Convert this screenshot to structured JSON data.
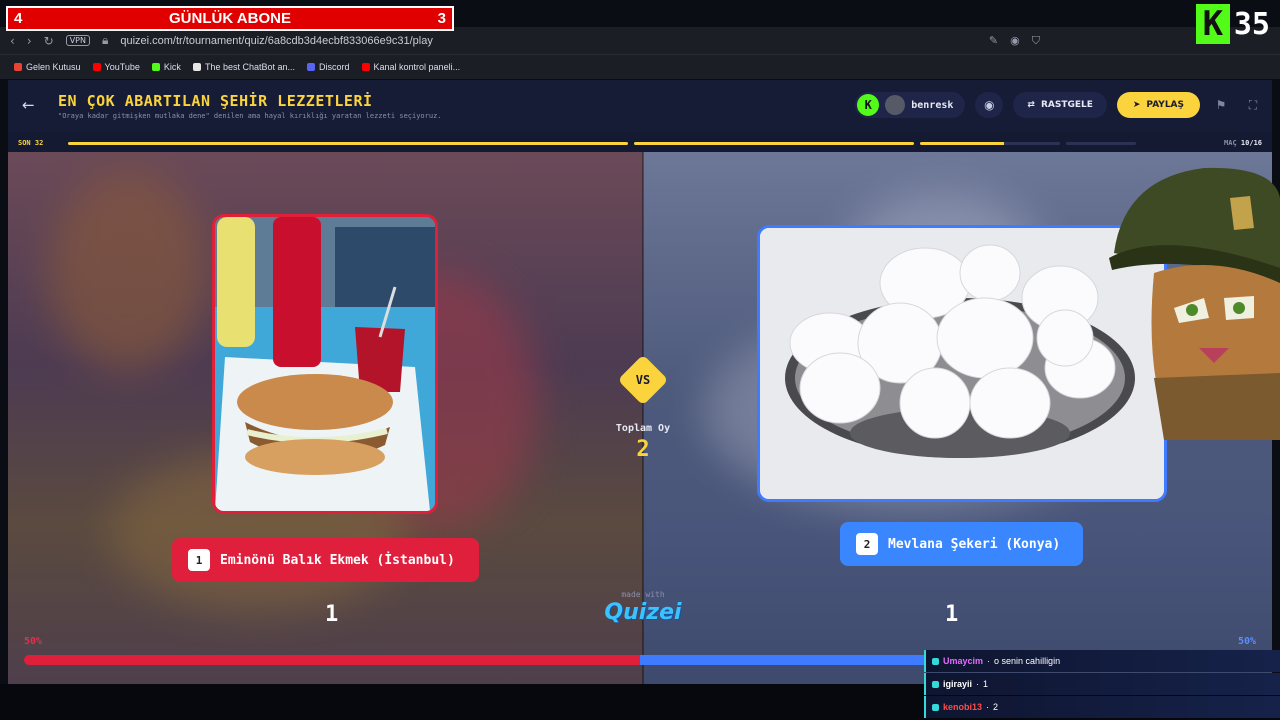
{
  "overlay": {
    "sub_left": "4",
    "sub_title": "GÜNLÜK ABONE",
    "sub_right": "3",
    "kick_letter": "K",
    "kick_count": "35"
  },
  "browser": {
    "vpn": "VPN",
    "url": "quizei.com/tr/tournament/quiz/6a8cdb3d4ecbf833066e9c31/play",
    "bookmarks": [
      "Gelen Kutusu",
      "YouTube",
      "Kick",
      "The best ChatBot an...",
      "Discord",
      "Kanal kontrol paneli..."
    ]
  },
  "header": {
    "title": "EN ÇOK ABARTILAN ŞEHİR LEZZETLERİ",
    "subtitle": "\"Oraya kadar gitmişken mutlaka dene\" denilen ama hayal kırıklığı yaratan lezzeti seçiyoruz.",
    "user_badge": "K",
    "username": "benresk",
    "random_label": "RASTGELE",
    "share_label": "PAYLAŞ"
  },
  "progress": {
    "round_label": "SON 32",
    "match_prefix": "MAÇ",
    "match_value": "10/16",
    "segments_filled": 2.6,
    "segments_total": 4
  },
  "match": {
    "left": {
      "number": "1",
      "name": "Eminönü Balık Ekmek (İstanbul)",
      "votes": "1",
      "percent": "50%"
    },
    "right": {
      "number": "2",
      "name": "Mevlana Şekeri (Konya)",
      "votes": "1",
      "percent": "50%"
    },
    "vs": "VS",
    "total_label": "Toplam Oy",
    "total_value": "2",
    "made_with": "made with",
    "brand": "Quizei",
    "left_share": 0.5
  },
  "chat": [
    {
      "user": "Umaycim",
      "user_color": "#e56cff",
      "message": "o senin cahilligin"
    },
    {
      "user": "igirayii",
      "user_color": "#ffffff",
      "message": "1"
    },
    {
      "user": "kenobi13",
      "user_color": "#ff4b4b",
      "message": "2"
    }
  ],
  "colors": {
    "accent_yellow": "#fbd33c",
    "red": "#e01f3d",
    "blue": "#3a86ff",
    "kick_green": "#53fc18"
  }
}
